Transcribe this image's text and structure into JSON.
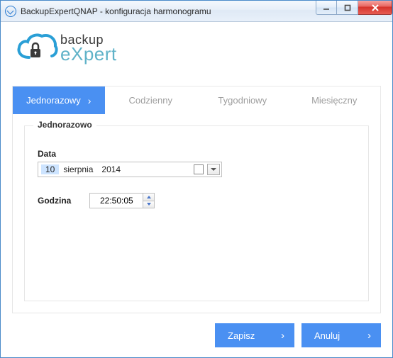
{
  "window": {
    "title": "BackupExpertQNAP - konfiguracja  harmonogramu"
  },
  "logo": {
    "line1": "backup",
    "line2_pre": "e",
    "line2_x": "X",
    "line2_post": "pert"
  },
  "tabs": {
    "one_time": "Jednorazowy",
    "daily": "Codzienny",
    "weekly": "Tygodniowy",
    "monthly": "Miesięczny"
  },
  "group": {
    "title": "Jednorazowo",
    "date_label": "Data",
    "date_day": "10",
    "date_month": "sierpnia",
    "date_year": "2014",
    "time_label": "Godzina",
    "time_value": "22:50:05"
  },
  "buttons": {
    "save": "Zapisz",
    "cancel": "Anuluj"
  }
}
